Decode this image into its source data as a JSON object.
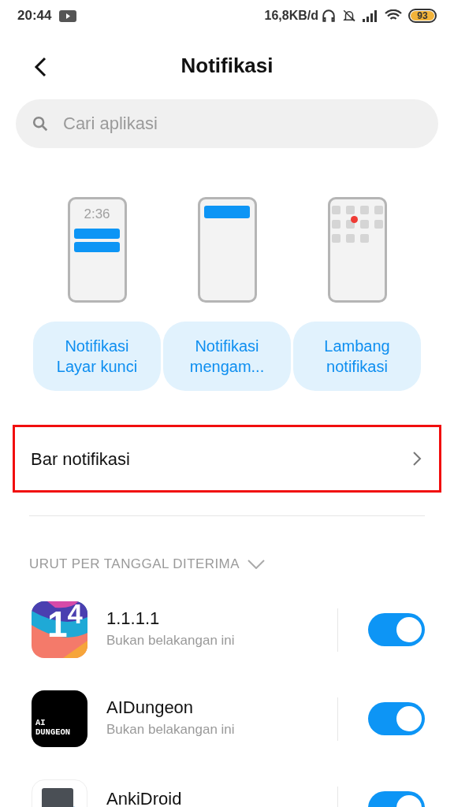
{
  "status_bar": {
    "time": "20:44",
    "speed": "16,8KB/d",
    "battery": "93"
  },
  "header": {
    "title": "Notifikasi"
  },
  "search": {
    "placeholder": "Cari aplikasi"
  },
  "styles": [
    {
      "kind": "lockscreen",
      "clock": "2:36",
      "label": "Notifikasi\nLayar kunci"
    },
    {
      "kind": "floating",
      "label": "Notifikasi\nmengam..."
    },
    {
      "kind": "badge",
      "label": "Lambang\nnotifikasi"
    }
  ],
  "notification_bar_row": {
    "label": "Bar notifikasi",
    "highlighted": true
  },
  "section": {
    "title": "URUT PER TANGGAL DITERIMA"
  },
  "apps": [
    {
      "kind": "cloudflare",
      "icon_text": "1$^{4}$",
      "name": "1.1.1.1",
      "subtitle": "Bukan belakangan ini",
      "on": true
    },
    {
      "kind": "dungeon",
      "icon_text": "AI\nDUNGEON",
      "name": "AIDungeon",
      "subtitle": "Bukan belakangan ini",
      "on": true
    },
    {
      "kind": "anki",
      "name": "AnkiDroid",
      "on": true
    }
  ]
}
